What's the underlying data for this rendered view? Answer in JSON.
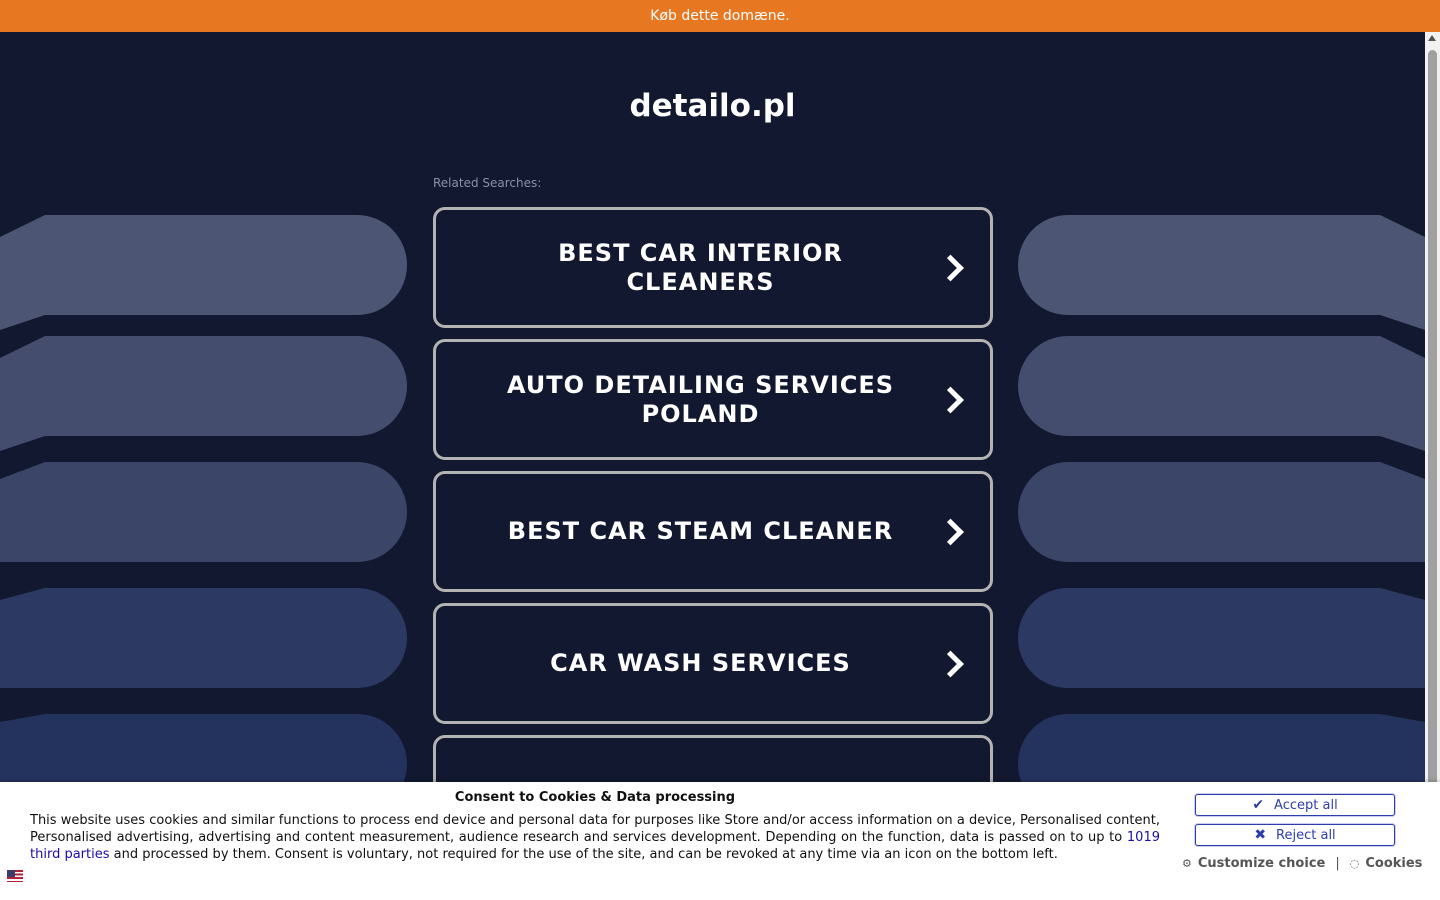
{
  "topbar": {
    "label": "Køb dette domæne."
  },
  "domain": {
    "title": "detailo.pl"
  },
  "related": {
    "label": "Related Searches:"
  },
  "links": [
    {
      "label": "BEST CAR INTERIOR CLEANERS"
    },
    {
      "label": "AUTO DETAILING SERVICES POLAND"
    },
    {
      "label": "BEST CAR STEAM CLEANER"
    },
    {
      "label": "CAR WASH SERVICES"
    },
    {
      "label": ""
    }
  ],
  "consent": {
    "title": "Consent to Cookies & Data processing",
    "text_before": "This website uses cookies and similar functions to process end device and personal data for purposes like Store and/or access information on a device, Personalised content, Personalised advertising, advertising and content measurement, audience research and services development. Depending on the function, data is passed on to up to ",
    "third_parties": "1019 third parties",
    "text_after": " and processed by them. Consent is voluntary, not required for the use of the site, and can be revoked at any time via an icon on the bottom left.",
    "accept": "Accept all",
    "reject": "Reject all",
    "customize": "Customize choice",
    "cookies": "Cookies",
    "separator": "|"
  },
  "colors": {
    "topbar": "#e87722",
    "background": "#12182f",
    "button_border": "#b3b3b3",
    "consent_button": "#2d3ea8"
  }
}
